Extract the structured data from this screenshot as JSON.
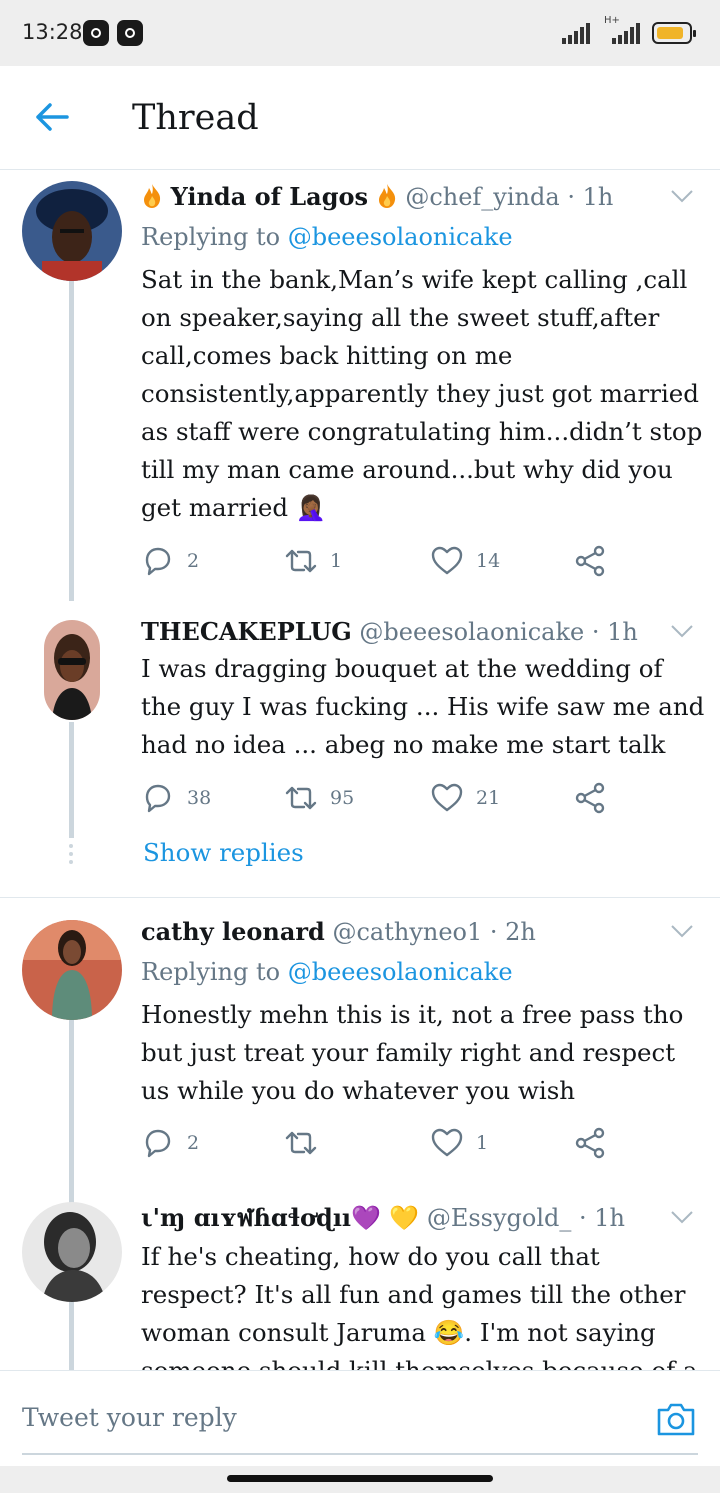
{
  "status_bar": {
    "time": "13:28",
    "network": "H+"
  },
  "header": {
    "title": "Thread",
    "back_icon": "arrow-left-icon"
  },
  "tweets": [
    {
      "name": "Yinda of Lagos",
      "name_emoji": "fire",
      "handle": "@chef_yinda",
      "time": "· 1h",
      "replying_label": "Replying to ",
      "replying_to": "@beeesolaonicake",
      "text": "Sat in the bank,Man’s wife kept calling ,call on speaker,saying all the sweet stuff,after call,comes back hitting on me consistently,apparently they just got married as staff were congratulating him...didn’t stop till my man came around...but why did you get married 🤦🏾‍♀️",
      "replies": "2",
      "retweets": "1",
      "likes": "14"
    },
    {
      "name": "THECAKEPLUG",
      "handle": "@beeesolaonicake",
      "time": "· 1h",
      "text": "I was dragging bouquet at the wedding of the guy I was fucking ... His wife saw me and had no idea ... abeg no make me start talk",
      "replies": "38",
      "retweets": "95",
      "likes": "21"
    },
    {
      "name": "cathy leonard",
      "handle": "@cathyneo1",
      "time": "· 2h",
      "replying_label": "Replying to ",
      "replying_to": "@beeesolaonicake",
      "text": "Honestly mehn this is it, not a free pass tho but just treat your family right and respect us while you do whatever you wish",
      "replies": "2",
      "retweets": "",
      "likes": "1"
    },
    {
      "name": "ι'ɱ ɑıʏฬɦɑɬơɖıı💜 💛",
      "handle": "@Essygold_",
      "time": "· 1h",
      "text": "If he's cheating, how do you call that respect? It's all fun and games till the other woman consult Jaruma 😂. I'm not saying someone should kill themselves because of a man but"
    }
  ],
  "show_replies": "Show replies",
  "reply_bar": {
    "placeholder": "Tweet your reply",
    "camera_icon": "camera-icon"
  },
  "colors": {
    "link": "#1b95e0",
    "secondary": "#657786",
    "thread_line": "#ccd6dd"
  }
}
